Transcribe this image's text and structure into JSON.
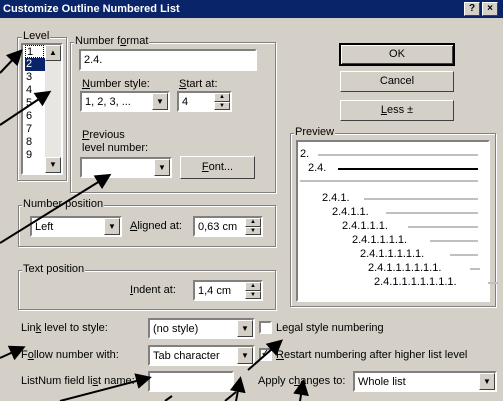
{
  "title": "Customize Outline Numbered List",
  "title_buttons": [
    "?",
    "×"
  ],
  "level": {
    "label": "Level",
    "items": [
      "1",
      "2",
      "3",
      "4",
      "5",
      "6",
      "7",
      "8",
      "9"
    ],
    "selected": "2"
  },
  "number_format": {
    "label": "Number format",
    "value": "2.4.",
    "number_style_label": "Number style:",
    "number_style_value": "1, 2, 3, ...",
    "start_at_label": "Start at:",
    "start_at_value": "4",
    "previous_label_1": "Previous",
    "previous_label_2": "level number:",
    "previous_value": "",
    "font_button": "Font..."
  },
  "buttons": {
    "ok": "OK",
    "cancel": "Cancel",
    "less": "Less ±"
  },
  "preview": {
    "label": "Preview",
    "lines": [
      "2.",
      "2.4.",
      "2.4.1.",
      "2.4.1.1.",
      "2.4.1.1.1.",
      "2.4.1.1.1.1.",
      "2.4.1.1.1.1.1.",
      "2.4.1.1.1.1.1.1.",
      "2.4.1.1.1.1.1.1.1."
    ]
  },
  "number_position": {
    "label": "Number position",
    "value": "Left",
    "aligned_label": "Aligned at:",
    "aligned_value": "0,63 cm"
  },
  "text_position": {
    "label": "Text position",
    "indent_label": "Indent at:",
    "indent_value": "1,4 cm"
  },
  "link_level": {
    "label": "Link level to style:",
    "value": "(no style)"
  },
  "follow_number": {
    "label": "Follow number with:",
    "value": "Tab character"
  },
  "listnum": {
    "label": "ListNum field list name:",
    "value": ""
  },
  "legal_style": {
    "label": "Legal style numbering",
    "checked": false
  },
  "restart": {
    "label": "Restart numbering after higher list level",
    "checked": true
  },
  "apply_changes": {
    "label": "Apply changes to:",
    "value": "Whole list"
  }
}
